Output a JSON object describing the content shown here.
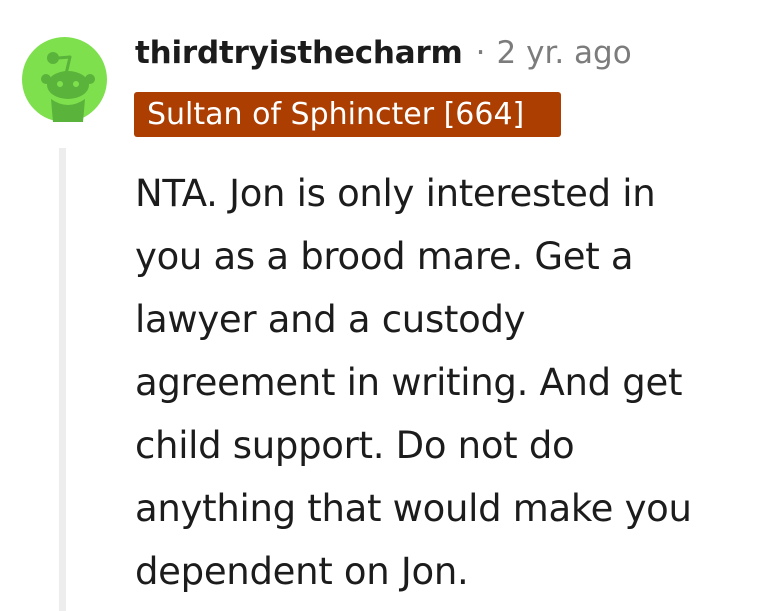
{
  "comment": {
    "username": "thirdtryisthecharm",
    "separator": "·",
    "timestamp": "2 yr. ago",
    "flair": "Sultan of Sphincter [664]",
    "lines": [
      "NTA. Jon is only interested in",
      "you as a brood mare. Get a",
      "lawyer and a custody",
      "agreement in writing. And get",
      "child support. Do not do",
      "anything that would make you",
      "dependent on Jon."
    ]
  },
  "colors": {
    "avatar_bg": "#7ee04d",
    "avatar_figure": "#5ab33b",
    "flair_bg": "#ad3e02",
    "thread_line": "#ededed",
    "text": "#1c1c1c",
    "muted": "#7c7c7c"
  },
  "icons": {
    "avatar": "reddit-snoo-avatar-icon"
  }
}
